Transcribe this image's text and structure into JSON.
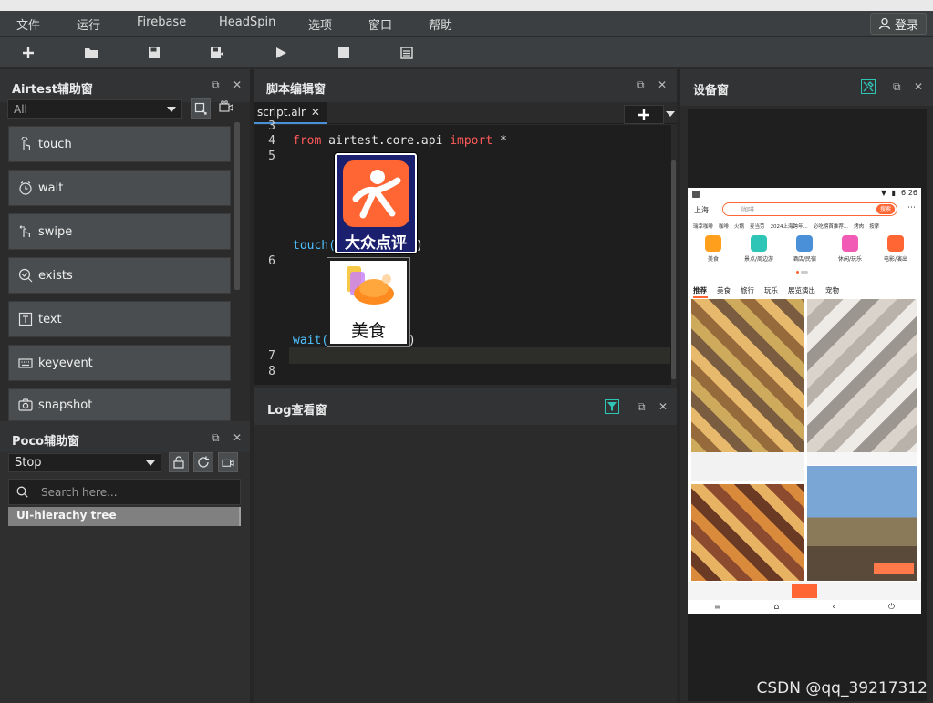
{
  "menu": {
    "file": "文件",
    "run": "运行",
    "firebase": "Firebase",
    "headspin": "HeadSpin",
    "options": "选项",
    "window": "窗口",
    "help": "帮助",
    "login": "登录"
  },
  "airtest_panel": {
    "title": "Airtest辅助窗",
    "filter_value": "All",
    "apis": [
      "touch",
      "wait",
      "swipe",
      "exists",
      "text",
      "keyevent",
      "snapshot"
    ]
  },
  "poco_panel": {
    "title": "Poco辅助窗",
    "mode_value": "Stop",
    "search_placeholder": "Search here...",
    "tree_root": "UI-hierachy tree"
  },
  "editor": {
    "title": "脚本编辑窗",
    "tab_name": "script.air",
    "lines": {
      "l3": "3",
      "l4": "4",
      "l5": "5",
      "l6": "6",
      "l7": "7",
      "l8": "8"
    },
    "code": {
      "from": "from",
      "module": "airtest.core.api",
      "import": "import",
      "star": "*",
      "touch": "touch(",
      "wait": "wait(",
      "close_paren": ")"
    },
    "template1_caption": "大众点评",
    "template2_caption": "美食"
  },
  "log_panel": {
    "title": "Log查看窗"
  },
  "device_panel": {
    "title": "设备窗",
    "phone": {
      "time": "6:26",
      "city": "上海",
      "search_placeholder": "咖啡",
      "search_button": "搜索",
      "hot_tags": [
        "瑞幸咖啡",
        "咖啡",
        "火锅",
        "麦当劳",
        "2024上海跨年...",
        "必吃榜首推荐...",
        "烤肉",
        "按摩"
      ],
      "categories": [
        "美食",
        "景点/周边游",
        "酒店/民宿",
        "休闲/玩乐",
        "电影/演出"
      ],
      "tabs": [
        "推荐",
        "美食",
        "旅行",
        "玩乐",
        "展览演出",
        "宠物"
      ]
    }
  },
  "watermark": "CSDN @qq_39217312",
  "colors": {
    "accent_orange": "#ff6633",
    "bg": "#2b2b2b",
    "panel_head": "#313335"
  }
}
